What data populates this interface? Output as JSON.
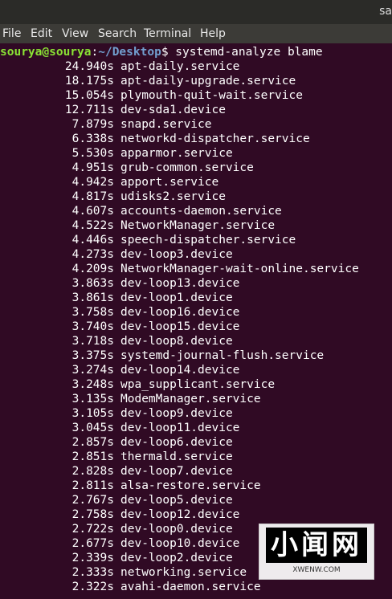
{
  "window": {
    "title": "sa"
  },
  "menu": [
    "File",
    "Edit",
    "View",
    "Search",
    "Terminal",
    "Help"
  ],
  "prompt": {
    "user": "sourya@sourya",
    "sep": ":",
    "path": "~/Desktop",
    "symbol": "$",
    "command": " systemd-analyze blame"
  },
  "blame": [
    {
      "time": "24.940s",
      "unit": "apt-daily.service"
    },
    {
      "time": "18.175s",
      "unit": "apt-daily-upgrade.service"
    },
    {
      "time": "15.054s",
      "unit": "plymouth-quit-wait.service"
    },
    {
      "time": "12.711s",
      "unit": "dev-sda1.device"
    },
    {
      "time": "7.879s",
      "unit": "snapd.service"
    },
    {
      "time": "6.338s",
      "unit": "networkd-dispatcher.service"
    },
    {
      "time": "5.530s",
      "unit": "apparmor.service"
    },
    {
      "time": "4.951s",
      "unit": "grub-common.service"
    },
    {
      "time": "4.942s",
      "unit": "apport.service"
    },
    {
      "time": "4.817s",
      "unit": "udisks2.service"
    },
    {
      "time": "4.607s",
      "unit": "accounts-daemon.service"
    },
    {
      "time": "4.522s",
      "unit": "NetworkManager.service"
    },
    {
      "time": "4.446s",
      "unit": "speech-dispatcher.service"
    },
    {
      "time": "4.273s",
      "unit": "dev-loop3.device"
    },
    {
      "time": "4.209s",
      "unit": "NetworkManager-wait-online.service"
    },
    {
      "time": "3.863s",
      "unit": "dev-loop13.device"
    },
    {
      "time": "3.861s",
      "unit": "dev-loop1.device"
    },
    {
      "time": "3.758s",
      "unit": "dev-loop16.device"
    },
    {
      "time": "3.740s",
      "unit": "dev-loop15.device"
    },
    {
      "time": "3.718s",
      "unit": "dev-loop8.device"
    },
    {
      "time": "3.375s",
      "unit": "systemd-journal-flush.service"
    },
    {
      "time": "3.274s",
      "unit": "dev-loop14.device"
    },
    {
      "time": "3.248s",
      "unit": "wpa_supplicant.service"
    },
    {
      "time": "3.135s",
      "unit": "ModemManager.service"
    },
    {
      "time": "3.105s",
      "unit": "dev-loop9.device"
    },
    {
      "time": "3.045s",
      "unit": "dev-loop11.device"
    },
    {
      "time": "2.857s",
      "unit": "dev-loop6.device"
    },
    {
      "time": "2.851s",
      "unit": "thermald.service"
    },
    {
      "time": "2.828s",
      "unit": "dev-loop7.device"
    },
    {
      "time": "2.811s",
      "unit": "alsa-restore.service"
    },
    {
      "time": "2.767s",
      "unit": "dev-loop5.device"
    },
    {
      "time": "2.758s",
      "unit": "dev-loop12.device"
    },
    {
      "time": "2.722s",
      "unit": "dev-loop0.device"
    },
    {
      "time": "2.677s",
      "unit": "dev-loop10.device"
    },
    {
      "time": "2.339s",
      "unit": "dev-loop2.device"
    },
    {
      "time": "2.333s",
      "unit": "networking.service"
    },
    {
      "time": "2.322s",
      "unit": "avahi-daemon.service"
    }
  ],
  "watermark": {
    "logo": "小闻网",
    "url": "XWENW.COM"
  },
  "colors": {
    "terminal_bg": "#300a24",
    "user": "#8ae234",
    "path": "#729fcf",
    "menubar": "#3c3b37"
  }
}
